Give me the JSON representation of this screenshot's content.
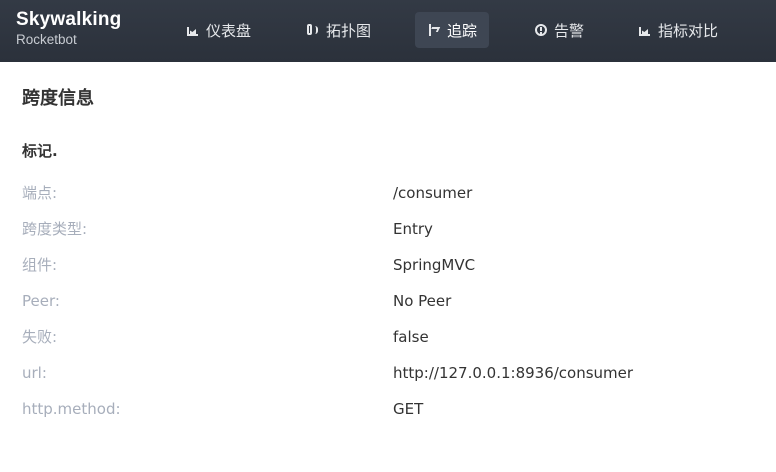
{
  "brand": {
    "name": "Skywalking",
    "sub": "Rocketbot"
  },
  "nav": [
    {
      "label": "仪表盘",
      "icon": "dashboard-chart-icon",
      "active": false
    },
    {
      "label": "拓扑图",
      "icon": "topology-icon",
      "active": false
    },
    {
      "label": "追踪",
      "icon": "trace-icon",
      "active": true
    },
    {
      "label": "告警",
      "icon": "alarm-icon",
      "active": false
    },
    {
      "label": "指标对比",
      "icon": "metrics-compare-chart-icon",
      "active": false
    }
  ],
  "colors": {
    "topbar": "#2f3640",
    "nav_active_bg": "#3e4653",
    "label_gray": "#a7aebb",
    "text_dark": "#333333"
  },
  "panel": {
    "title": "跨度信息",
    "tags_title": "标记.",
    "rows": [
      {
        "key": "端点:",
        "value": "/consumer"
      },
      {
        "key": "跨度类型:",
        "value": "Entry"
      },
      {
        "key": "组件:",
        "value": "SpringMVC"
      },
      {
        "key": "Peer:",
        "value": "No Peer"
      },
      {
        "key": "失败:",
        "value": "false"
      },
      {
        "key": "url:",
        "value": "http://127.0.0.1:8936/consumer"
      },
      {
        "key": "http.method:",
        "value": "GET"
      }
    ]
  }
}
